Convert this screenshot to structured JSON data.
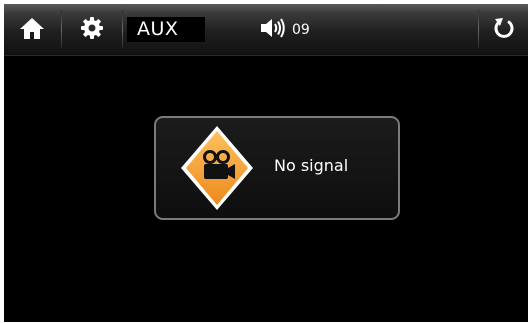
{
  "topbar": {
    "home_icon": "home-icon",
    "settings_icon": "gear-icon",
    "source_label": "AUX",
    "volume_icon": "speaker-icon",
    "volume_level": "09",
    "back_icon": "refresh-icon"
  },
  "dialog": {
    "icon": "camera-warning-icon",
    "message": "No signal"
  },
  "colors": {
    "icon_orange": "#f5a43b",
    "screen_bg": "#000000",
    "dialog_border": "#7a7a7a"
  }
}
